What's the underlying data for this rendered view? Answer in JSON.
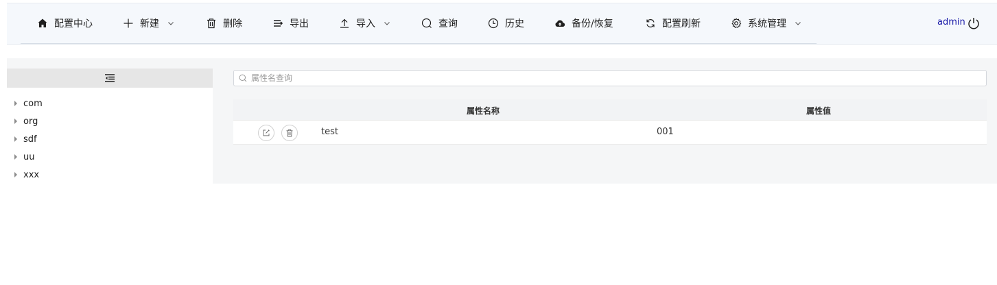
{
  "menu": {
    "home": "配置中心",
    "new": "新建",
    "delete": "删除",
    "export": "导出",
    "import": "导入",
    "query": "查询",
    "history": "历史",
    "backup": "备份/恢复",
    "refresh": "配置刷新",
    "system": "系统管理"
  },
  "user": {
    "name": "admin"
  },
  "tree": {
    "items": [
      {
        "label": "com"
      },
      {
        "label": "org"
      },
      {
        "label": "sdf"
      },
      {
        "label": "uu"
      },
      {
        "label": "xxx"
      }
    ]
  },
  "search": {
    "placeholder": "属性名查询",
    "value": ""
  },
  "table": {
    "columns": {
      "name": "属性名称",
      "value": "属性值"
    },
    "rows": [
      {
        "name": "test",
        "value": "001"
      }
    ]
  }
}
